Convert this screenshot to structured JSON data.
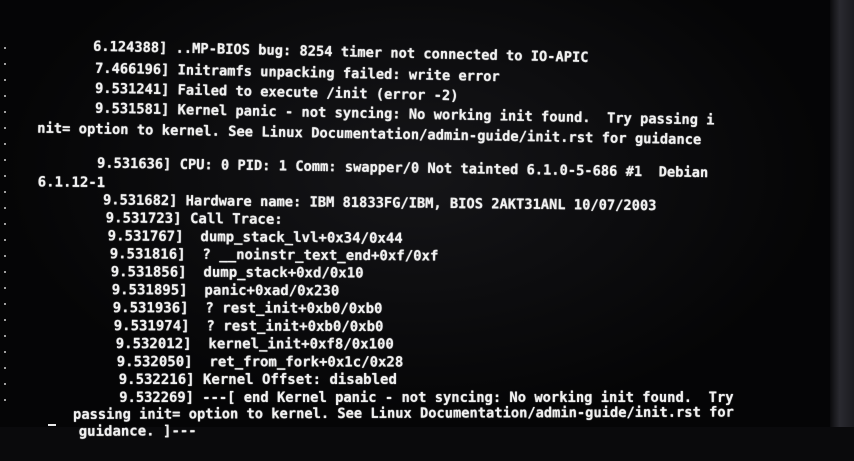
{
  "console": {
    "lines": [
      {
        "ts": "6.124388]",
        "msg": " ..MP-BIOS bug: 8254 timer not connected to IO-APIC"
      },
      {
        "ts": "7.466196]",
        "msg": " Initramfs unpacking failed: write error"
      },
      {
        "ts": "9.531241]",
        "msg": " Failed to execute /init (error -2)"
      },
      {
        "ts": "9.531581]",
        "msg": " Kernel panic - not syncing: No working init found.  Try passing i"
      },
      {
        "ts": "",
        "msg": "nit= option to kernel. See Linux Documentation/admin-guide/init.rst for guidance"
      },
      {
        "ts": "9.531636]",
        "msg": " CPU: 0 PID: 1 Comm: swapper/0 Not tainted 6.1.0-5-686 #1  Debian"
      },
      {
        "ts": "",
        "msg": "6.1.12-1"
      },
      {
        "ts": "9.531682]",
        "msg": " Hardware name: IBM 81833FG/IBM, BIOS 2AKT31ANL 10/07/2003"
      },
      {
        "ts": "9.531723]",
        "msg": " Call Trace:"
      },
      {
        "ts": "9.531767]",
        "msg": "  dump_stack_lvl+0x34/0x44"
      },
      {
        "ts": "9.531816]",
        "msg": "  ? __noinstr_text_end+0xf/0xf"
      },
      {
        "ts": "9.531856]",
        "msg": "  dump_stack+0xd/0x10"
      },
      {
        "ts": "9.531895]",
        "msg": "  panic+0xad/0x230"
      },
      {
        "ts": "9.531936]",
        "msg": "  ? rest_init+0xb0/0xb0"
      },
      {
        "ts": "9.531974]",
        "msg": "  ? rest_init+0xb0/0xb0"
      },
      {
        "ts": "9.532012]",
        "msg": "  kernel_init+0xf8/0x100"
      },
      {
        "ts": "9.532050]",
        "msg": "  ret_from_fork+0x1c/0x28"
      },
      {
        "ts": "9.532216]",
        "msg": " Kernel Offset: disabled"
      },
      {
        "ts": "9.532269]",
        "msg": " ---[ end Kernel panic - not syncing: No working init found.  Try"
      },
      {
        "ts": "",
        "msg": "passing init= option to kernel. See Linux Documentation/admin-guide/init.rst for"
      },
      {
        "ts": "",
        "msg": "guidance. ]---"
      }
    ]
  }
}
